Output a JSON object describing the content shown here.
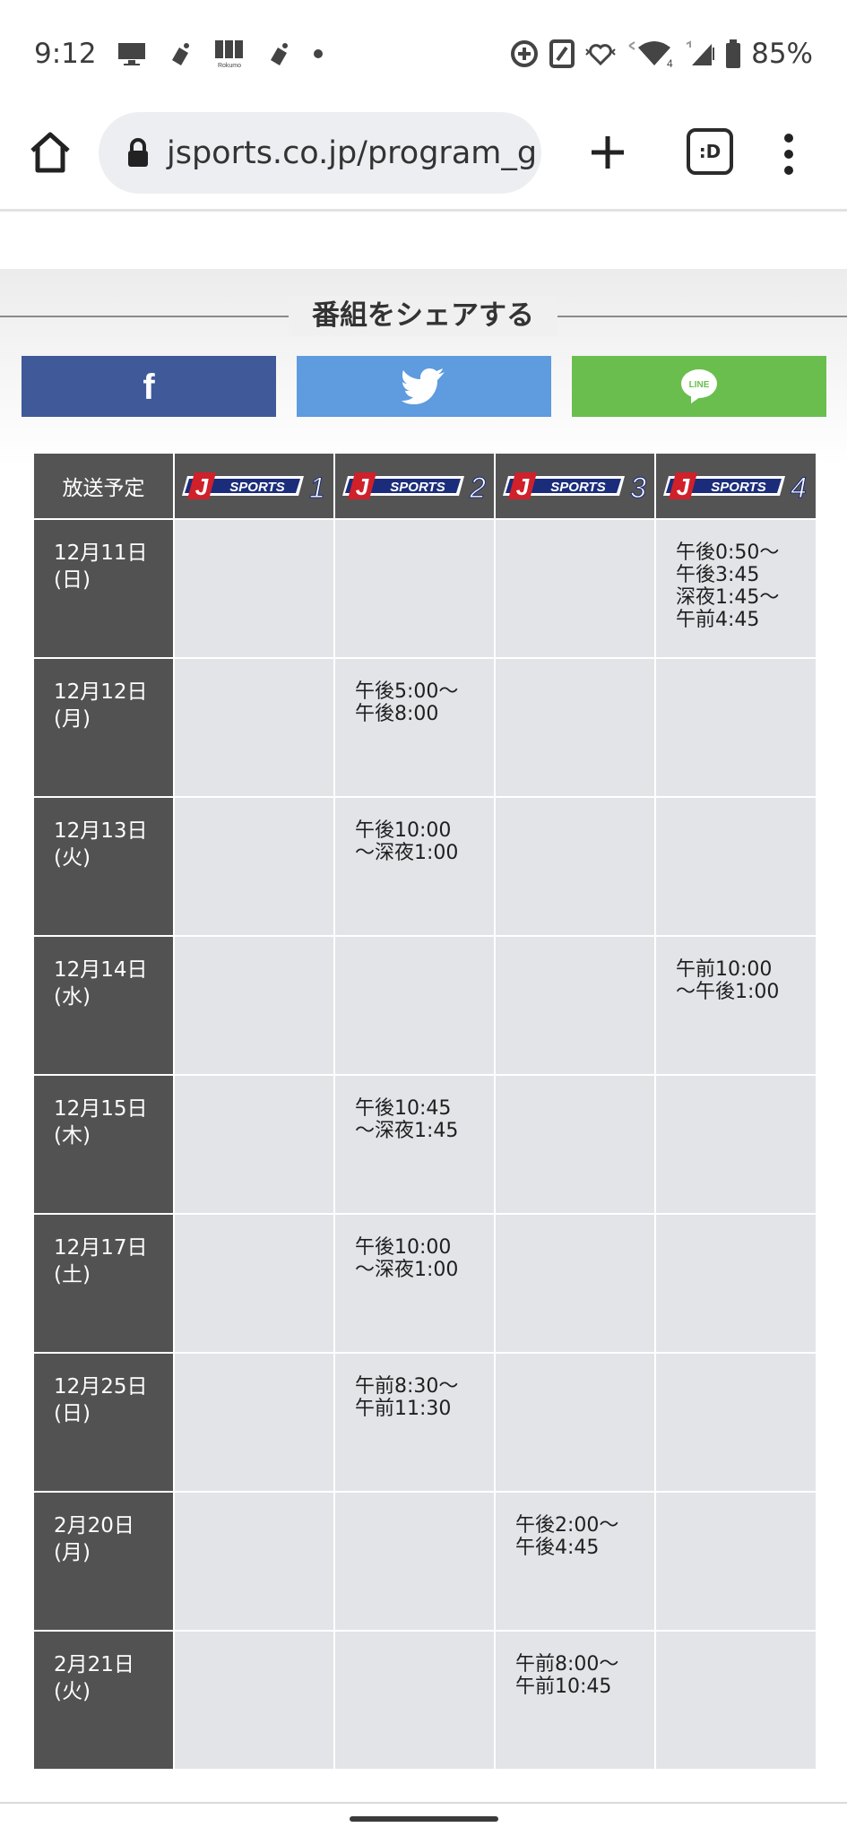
{
  "status_bar": {
    "time": "9:12",
    "battery": "85%",
    "rokumo_label": "Rokumo",
    "lte_label": "4"
  },
  "browser": {
    "url": "jsports.co.jp/program_g",
    "tabs_label": ":D"
  },
  "share": {
    "heading": "番組をシェアする",
    "facebook": "f",
    "twitter": "twitter",
    "line": "LINE"
  },
  "schedule": {
    "header_label": "放送予定",
    "channels": [
      {
        "brand": "SPORTS",
        "number": "1"
      },
      {
        "brand": "SPORTS",
        "number": "2"
      },
      {
        "brand": "SPORTS",
        "number": "3"
      },
      {
        "brand": "SPORTS",
        "number": "4"
      }
    ],
    "rows": [
      {
        "date": "12月11日",
        "day": "(日)",
        "slots": [
          [],
          [],
          [],
          [
            "午後0:50～",
            "午後3:45",
            "深夜1:45～",
            "午前4:45"
          ]
        ]
      },
      {
        "date": "12月12日",
        "day": "(月)",
        "slots": [
          [],
          [
            "午後5:00～",
            "午後8:00"
          ],
          [],
          []
        ]
      },
      {
        "date": "12月13日",
        "day": "(火)",
        "slots": [
          [],
          [
            "午後10:00",
            "～深夜1:00"
          ],
          [],
          []
        ]
      },
      {
        "date": "12月14日",
        "day": "(水)",
        "slots": [
          [],
          [],
          [],
          [
            "午前10:00",
            "～午後1:00"
          ]
        ]
      },
      {
        "date": "12月15日",
        "day": "(木)",
        "slots": [
          [],
          [
            "午後10:45",
            "～深夜1:45"
          ],
          [],
          []
        ]
      },
      {
        "date": "12月17日",
        "day": "(土)",
        "slots": [
          [],
          [
            "午後10:00",
            "～深夜1:00"
          ],
          [],
          []
        ]
      },
      {
        "date": "12月25日",
        "day": "(日)",
        "slots": [
          [],
          [
            "午前8:30～",
            "午前11:30"
          ],
          [],
          []
        ]
      },
      {
        "date": "2月20日",
        "day": "(月)",
        "slots": [
          [],
          [],
          [
            "午後2:00～",
            "午後4:45"
          ],
          []
        ]
      },
      {
        "date": "2月21日",
        "day": "(火)",
        "slots": [
          [],
          [],
          [
            "午前8:00～",
            "午前10:45"
          ],
          []
        ]
      }
    ]
  },
  "colors": {
    "facebook": "#3f5999",
    "twitter": "#5e9bdf",
    "line": "#6abe4d",
    "header_bg": "#545454",
    "cell_bg": "#e3e4e8",
    "logo_red": "#d0202a",
    "logo_navy": "#1b2d7a"
  },
  "icons": {
    "status_left": [
      "monitor-icon",
      "app-icon",
      "rokumo-icon",
      "app-icon",
      "dot-icon"
    ],
    "status_right": [
      "data-saver-icon",
      "nfc-icon",
      "heart-vibrate-icon",
      "wifi-icon",
      "signal-icon",
      "battery-icon"
    ],
    "browser": [
      "home-icon",
      "lock-icon",
      "plus-icon",
      "tab-switcher-icon",
      "more-vert-icon"
    ]
  }
}
